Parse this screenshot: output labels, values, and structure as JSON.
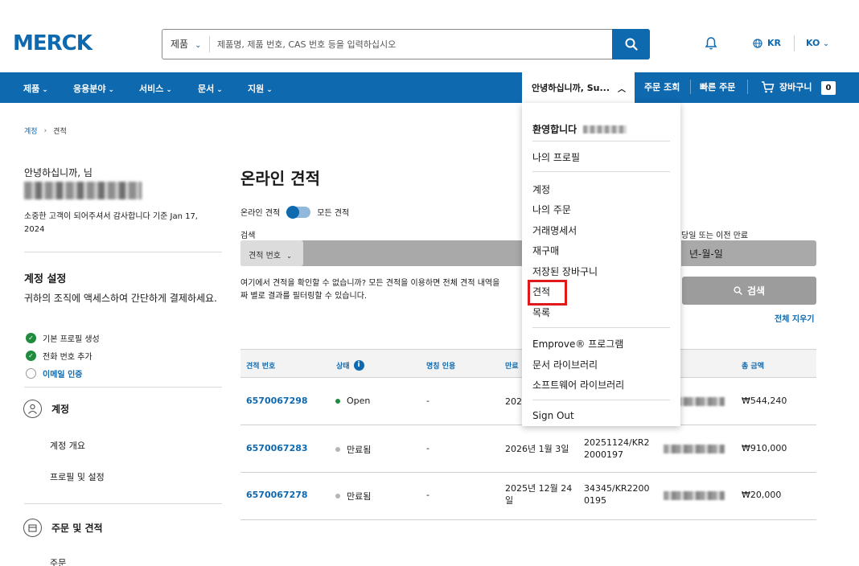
{
  "header": {
    "logo": "MERCK",
    "search_category": "제품",
    "search_placeholder": "제품명, 제품 번호, CAS 번호 등을 입력하십시오",
    "region": "KR",
    "language": "KO"
  },
  "nav": {
    "items": [
      "제품",
      "응용분야",
      "서비스",
      "문서",
      "지원"
    ],
    "greeting": "안녕하십니까, Su...",
    "order_status": "주문 조회",
    "quick_order": "빠른 주문",
    "cart": "장바구니",
    "cart_count": "0"
  },
  "breadcrumb": [
    "계정",
    "견적"
  ],
  "sidebar": {
    "hello": "안녕하십니까, 님",
    "thanks": "소중한 고객이 되어주셔서 감사합니다 기준 Jan 17, 2024",
    "settings_title": "계정 설정",
    "settings_desc": "귀하의 조직에 액세스하여 간단하게 결제하세요.",
    "checks": [
      {
        "label": "기본 프로필 생성",
        "done": true
      },
      {
        "label": "전화 번호 추가",
        "done": true
      },
      {
        "label": "이메일 인증",
        "done": false
      }
    ],
    "account_section": "계정",
    "account_links": [
      "계정 개요",
      "프로필 및 설정"
    ],
    "orders_section": "주문 및 견적",
    "orders_links": [
      "주문"
    ]
  },
  "main": {
    "title": "온라인 견적",
    "toggle_left": "온라인 견적",
    "toggle_right": "모든 견적",
    "search_label": "검색",
    "filter_select": "견적 번호",
    "help_text_1": "여기에서 견적을 확인할 수 없습니까? 모든 견적을 이용하면 전체 견적 내역을",
    "help_text_2": "짜 별로 결과를 필터링할 수 있습니다.",
    "date_label": "당일 또는 이전 만료",
    "date_placeholder": "년-월-일",
    "search_button": "검색",
    "clear_all": "전체 지우기"
  },
  "table": {
    "headers": [
      "견적 번호",
      "상태",
      "명칭 인용",
      "만료",
      "",
      "총 금액"
    ],
    "rows": [
      {
        "id": "6570067298",
        "status": "Open",
        "status_color": "#1f8b3c",
        "name": "-",
        "expiry_1": "2025",
        "expiry_2": "",
        "ref_1": "",
        "ref_2": "",
        "amount": "₩544,240"
      },
      {
        "id": "6570067283",
        "status": "만료됨",
        "status_color": "#b5b5b5",
        "name": "-",
        "expiry_1": "2026년 1월 3일",
        "expiry_2": "",
        "ref_1": "20251124/KR2",
        "ref_2": "2000197",
        "amount": "₩910,000"
      },
      {
        "id": "6570067278",
        "status": "만료됨",
        "status_color": "#b5b5b5",
        "name": "-",
        "expiry_1": "2025년 12월 24",
        "expiry_2": "일",
        "ref_1": "34345/KR2200",
        "ref_2": "0195",
        "amount": "₩20,000"
      }
    ]
  },
  "dropdown": {
    "welcome": "환영합니다",
    "profile": "나의 프로필",
    "items": [
      "계정",
      "나의 주문",
      "거래명세서",
      "재구매",
      "저장된 장바구니",
      "견적",
      "목록"
    ],
    "programs": [
      "Emprove® 프로그램",
      "문서 라이브러리",
      "소프트웨어 라이브러리"
    ],
    "sign_out": "Sign Out",
    "highlight_color": "#e01a1a"
  },
  "colors": {
    "brand": "#0f69af",
    "success": "#1f8b3c"
  }
}
